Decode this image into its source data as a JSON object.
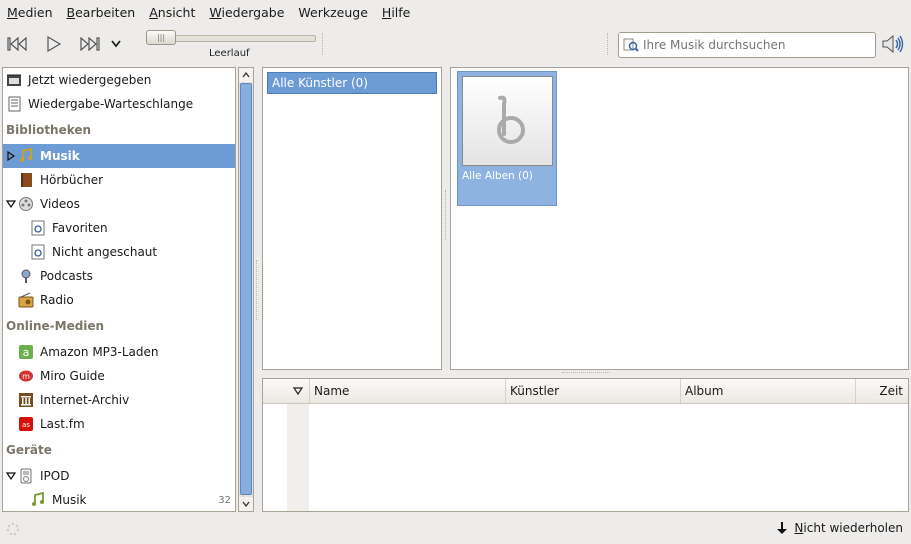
{
  "menubar": {
    "items": [
      {
        "first": "M",
        "rest": "edien"
      },
      {
        "first": "B",
        "rest": "earbeiten"
      },
      {
        "first": "A",
        "rest": "nsicht"
      },
      {
        "first": "W",
        "rest": "iedergabe"
      },
      {
        "first": "Werk",
        "rest": "zeuge",
        "underline_index": 4
      },
      {
        "first": "H",
        "rest": "ilfe"
      }
    ]
  },
  "toolbar": {
    "prev_icon": "skip-back-icon",
    "play_icon": "play-icon",
    "next_icon": "skip-forward-icon",
    "next_menu_icon": "chevron-down-icon",
    "status": "Leerlauf",
    "search_placeholder": "Ihre Musik durchsuchen",
    "volume_icon": "speaker-icon"
  },
  "sidebar": {
    "items": [
      {
        "label": "Jetzt wiedergegeben",
        "icon": "now-playing-icon"
      },
      {
        "label": "Wiedergabe-Warteschlange",
        "icon": "queue-icon"
      },
      {
        "header": "Bibliotheken"
      },
      {
        "label": "Musik",
        "icon": "music-note-icon",
        "selected": true
      },
      {
        "label": "Hörbücher",
        "icon": "book-icon"
      },
      {
        "label": "Videos",
        "icon": "video-icon"
      },
      {
        "label": "Favoriten",
        "icon": "smart-playlist-icon"
      },
      {
        "label": "Nicht angeschaut",
        "icon": "smart-playlist-icon"
      },
      {
        "label": "Podcasts",
        "icon": "podcast-icon"
      },
      {
        "label": "Radio",
        "icon": "radio-icon"
      },
      {
        "header": "Online-Medien"
      },
      {
        "label": "Amazon MP3-Laden",
        "icon": "amazon-icon"
      },
      {
        "label": "Miro Guide",
        "icon": "miro-icon"
      },
      {
        "label": "Internet-Archiv",
        "icon": "archive-icon"
      },
      {
        "label": "Last.fm",
        "icon": "lastfm-icon"
      },
      {
        "header": "Geräte"
      },
      {
        "label": "IPOD",
        "icon": "ipod-icon"
      },
      {
        "label": "Musik",
        "icon": "music-note-icon",
        "count": "32"
      }
    ]
  },
  "artists": {
    "all": "Alle Künstler (0)"
  },
  "albums": {
    "all": "Alle Alben (0)"
  },
  "tracklist": {
    "columns": [
      "Name",
      "Künstler",
      "Album",
      "Zeit"
    ]
  },
  "statusbar": {
    "repeat_first": "N",
    "repeat_rest": "icht wiederholen"
  },
  "colors": {
    "selection": "#6d9bd3",
    "background": "#edeceb"
  }
}
